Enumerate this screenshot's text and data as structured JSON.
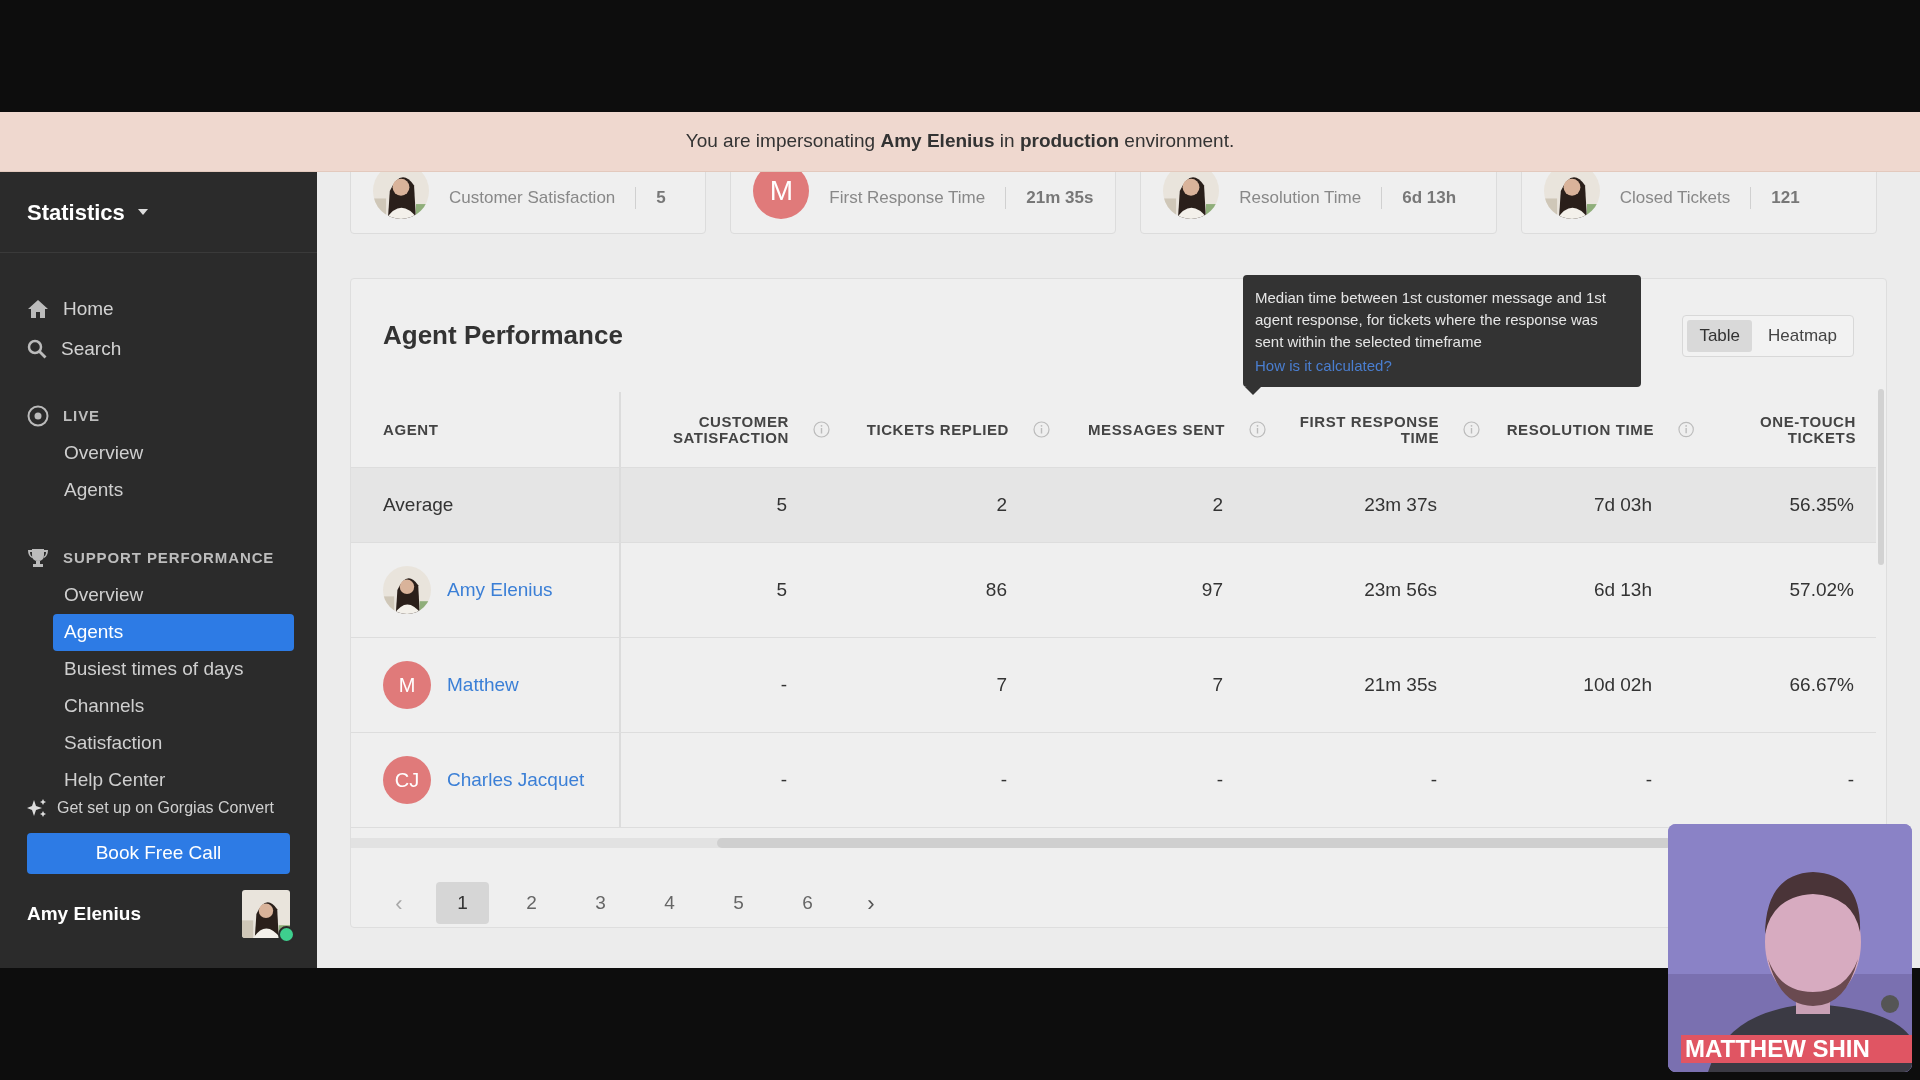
{
  "banner": {
    "text": "You are impersonating **Amy Elenius** in **production** environment."
  },
  "sidebar": {
    "title": "Statistics",
    "top_links": [
      {
        "label": "Home",
        "selected": false
      },
      {
        "label": "Search",
        "selected": false
      }
    ],
    "sections": [
      {
        "title": "LIVE",
        "items": [
          {
            "label": "Overview",
            "selected": false
          },
          {
            "label": "Agents",
            "selected": false
          }
        ]
      },
      {
        "title": "SUPPORT PERFORMANCE",
        "items": [
          {
            "label": "Overview",
            "selected": false
          },
          {
            "label": "Agents",
            "selected": true
          },
          {
            "label": "Busiest times of days",
            "selected": false
          },
          {
            "label": "Channels",
            "selected": false
          },
          {
            "label": "Satisfaction",
            "selected": false
          },
          {
            "label": "Help Center",
            "selected": false
          }
        ]
      }
    ],
    "promo": "Get set up on Gorgias Convert",
    "button": "Book Free Call",
    "user": {
      "name": "Amy Elenius",
      "online": true
    }
  },
  "summary_cards": [
    {
      "label": "Customer Satisfaction",
      "value": "5"
    },
    {
      "avatar": {
        "kind": "initials",
        "initials": "M",
        "color": "#e07a7a"
      },
      "label": "First Response Time",
      "value": "21m 35s"
    },
    {
      "label": "Resolution Time",
      "value": "6d 13h"
    },
    {
      "label": "Closed Tickets",
      "value": "121"
    }
  ],
  "panel": {
    "title": "Agent Performance",
    "view_toggle": [
      {
        "label": "Table",
        "selected": true
      },
      {
        "label": "Heatmap",
        "selected": false
      }
    ],
    "tooltip": {
      "text": "Median time between 1st customer message and 1st agent response, for tickets where the response was sent within the selected timeframe",
      "link": "How is it calculated?"
    },
    "table": {
      "columns": [
        {
          "label": "AGENT",
          "info": false
        },
        {
          "label": "CUSTOMER SATISFACTION",
          "info": false
        },
        {
          "label": "TICKETS REPLIED",
          "info": true
        },
        {
          "label": "MESSAGES SENT",
          "info": true
        },
        {
          "label": "FIRST RESPONSE TIME",
          "info": true
        },
        {
          "label": "RESOLUTION TIME",
          "info": true
        },
        {
          "label": "ONE-TOUCH TICKETS",
          "info": true
        }
      ],
      "rows": [
        {
          "kind": "average",
          "cells": [
            "Average",
            "5",
            "2",
            "2",
            "23m 37s",
            "7d 03h",
            "56.35%"
          ]
        },
        {
          "kind": "agent",
          "cells": [
            "Amy Elenius",
            "5",
            "86",
            "97",
            "23m 56s",
            "6d 13h",
            "57.02%"
          ]
        },
        {
          "kind": "agent",
          "avatar": {
            "kind": "initials",
            "initials": "M",
            "color": "#e07a7a"
          },
          "cells": [
            "Matthew",
            "-",
            "7",
            "7",
            "21m 35s",
            "10d 02h",
            "66.67%"
          ]
        },
        {
          "kind": "agent",
          "avatar": {
            "kind": "initials",
            "initials": "CJ",
            "color": "#e07a7a"
          },
          "cells": [
            "Charles Jacquet",
            "-",
            "-",
            "-",
            "-",
            "-",
            "-"
          ]
        }
      ]
    },
    "pagination": {
      "prev": "‹",
      "next": "›",
      "prev_disabled": true,
      "pages": [
        {
          "label": "1",
          "selected": true
        },
        {
          "label": "2",
          "selected": false
        },
        {
          "label": "3",
          "selected": false
        },
        {
          "label": "4",
          "selected": false
        },
        {
          "label": "5",
          "selected": false
        },
        {
          "label": "6",
          "selected": false
        }
      ]
    }
  },
  "webcam": {
    "caption": "MATTHEW SHIN"
  }
}
